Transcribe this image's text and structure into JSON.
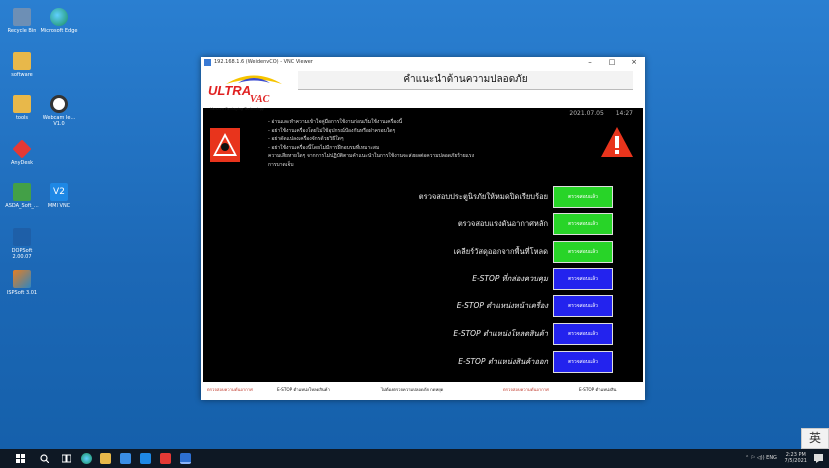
{
  "desktop": {
    "icons": [
      {
        "label": "Recycle Bin",
        "color": "#5a7fa8"
      },
      {
        "label": "Microsoft Edge",
        "color": "#2aa36b"
      },
      {
        "label": "software",
        "color": "#e8b84a"
      },
      {
        "label": "tools",
        "color": "#e8b84a"
      },
      {
        "label": "Webcam Ie... V1.0",
        "color": "#333333"
      },
      {
        "label": "AnyDesk",
        "color": "#e53935"
      },
      {
        "label": "ASDA_Soft_...",
        "color": "#43a047"
      },
      {
        "label": "MMI VNC",
        "color": "#1e88e5"
      },
      {
        "label": "DOPSoft 2.00.07",
        "color": "#1e5fa8"
      },
      {
        "label": "ISPSoft 3.01",
        "color": "#e67e22"
      }
    ]
  },
  "window": {
    "title": "192.168.1.6 (WeidenvCO) - VNC Viewer",
    "minimize": "–",
    "maximize": "□",
    "close": "×"
  },
  "hmi": {
    "title": "คำแนะนำด้านความปลอดภัย",
    "logo_ultra": "ULTRA",
    "logo_vac": "VAC",
    "logo_sub": "Vacuum Packaging Technology",
    "date": "2021.07.05",
    "time": "14:27",
    "notes": [
      "- อ่านและทำความเข้าใจคู่มือการใช้งานก่อนเริ่มใช้งานเครื่องนี้",
      "- อย่าใช้งานเครื่องโดยไม่ใช้อุปกรณ์ป้องกันหรือฝาครอบใดๆ",
      "- อย่าดัดแปลงเครื่องจักรด้วยวิธีใดๆ",
      "- อย่าใช้งานเครื่องนี้โดยไม่มีการฝึกอบรมที่เหมาะสม",
      "ความเสียหายใดๆ จากการไม่ปฏิบัติตามคำแนะนำในการใช้งานจะส่งผลต่อความปลอดภัยร้ายแรง",
      "การบาดเจ็บ"
    ],
    "checks": [
      {
        "label": "ตรวจสอบประตูนิรภัยให้หมดปิดเรียบร้อย",
        "button": "ตรวจสอบแล้ว",
        "status": "green",
        "italic": false
      },
      {
        "label": "ตรวจสอบแรงดันอากาศหลัก",
        "button": "ตรวจสอบแล้ว",
        "status": "green",
        "italic": false
      },
      {
        "label": "เคลียร์วัสดุออกจากพื้นที่โหลด",
        "button": "ตรวจสอบแล้ว",
        "status": "green",
        "italic": false
      },
      {
        "label": "E-STOP ที่กล่องควบคุม",
        "button": "ตรวจสอบแล้ว",
        "status": "blue",
        "italic": true
      },
      {
        "label": "E-STOP ตำแหน่งหน้าเครื่อง",
        "button": "ตรวจสอบแล้ว",
        "status": "blue",
        "italic": true
      },
      {
        "label": "E-STOP ตำแหน่งโหลดสินค้า",
        "button": "ตรวจสอบแล้ว",
        "status": "blue",
        "italic": true
      },
      {
        "label": "E-STOP ตำแหน่งสินค้าออก",
        "button": "ตรวจสอบแล้ว",
        "status": "blue",
        "italic": true
      }
    ],
    "footer": [
      "ตรวจสอบความดันอากาศ",
      "E-STOP ตำแหน่งโหลดสินค้า",
      "ไม่ต้องตรวจความปลอดภัย กดหยุด",
      "ตรวจสอบความดันอากาศ",
      "E-STOP ตำแหน่งสิน"
    ]
  },
  "taskbar": {
    "tray_text": "ENG",
    "clock": "2:23 PM",
    "date": "7/5/2021",
    "ime": "英"
  }
}
